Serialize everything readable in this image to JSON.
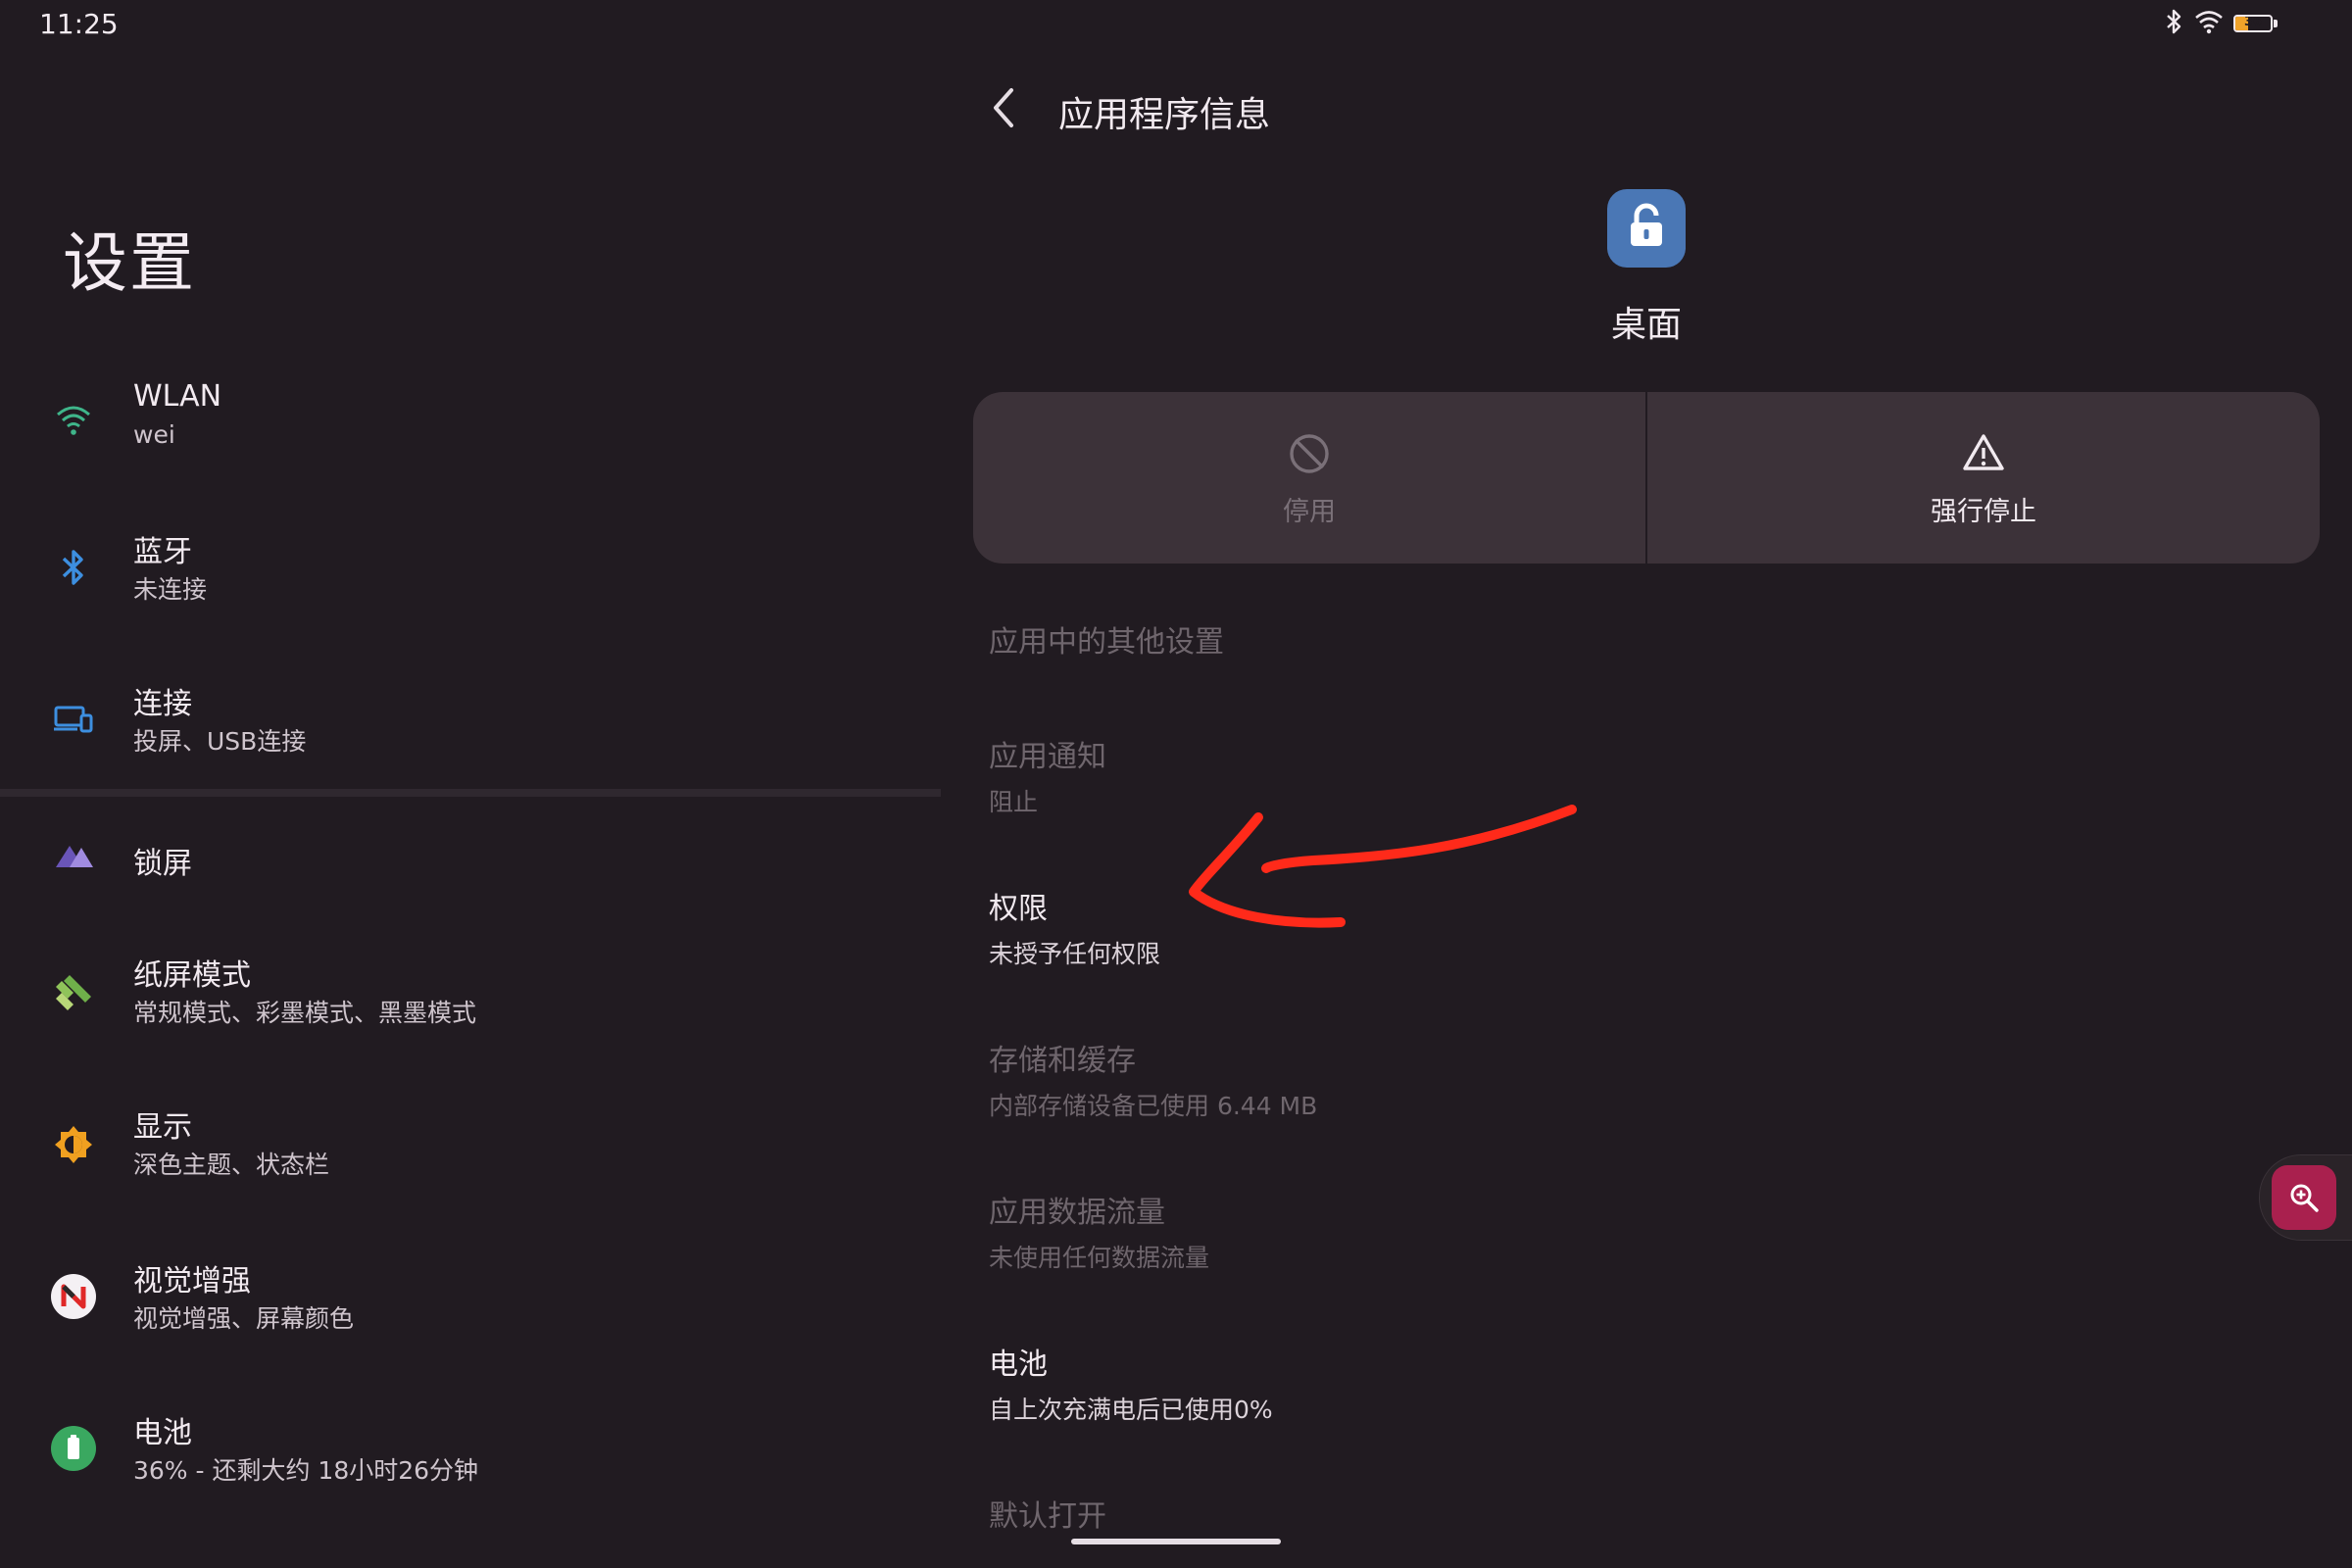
{
  "status_bar": {
    "time": "11:25",
    "battery_level": "36",
    "battery_percent": 0.36,
    "icons": [
      "bluetooth-icon",
      "wifi-icon",
      "battery-icon"
    ]
  },
  "settings_list": {
    "title": "设置",
    "items": [
      {
        "id": "wlan",
        "title": "WLAN",
        "subtitle": "wei",
        "icon": "wifi-icon",
        "icon_color": "#3fb58a"
      },
      {
        "id": "bluetooth",
        "title": "蓝牙",
        "subtitle": "未连接",
        "icon": "bluetooth-icon",
        "icon_color": "#3d8fe0"
      },
      {
        "id": "connect",
        "title": "连接",
        "subtitle": "投屏、USB连接",
        "icon": "devices-icon",
        "icon_color": "#3d8fe0"
      },
      {
        "id": "lockscreen",
        "title": "锁屏",
        "subtitle": "",
        "icon": "lockscreen-icon",
        "icon_color": "#8a6fd1"
      },
      {
        "id": "paper-mode",
        "title": "纸屏模式",
        "subtitle": "常规模式、彩墨模式、黑墨模式",
        "icon": "paper-mode-icon",
        "icon_color": "#8fc45a"
      },
      {
        "id": "display",
        "title": "显示",
        "subtitle": "深色主题、状态栏",
        "icon": "brightness-icon",
        "icon_color": "#f0a020"
      },
      {
        "id": "visual",
        "title": "视觉增强",
        "subtitle": "视觉增强、屏幕颜色",
        "icon": "visual-enhance-icon",
        "icon_color": "#e83030"
      },
      {
        "id": "battery",
        "title": "电池",
        "subtitle": "36% - 还剩大约 18小时26分钟",
        "icon": "battery-icon",
        "icon_color": "#3aa860"
      }
    ]
  },
  "app_info": {
    "page_title": "应用程序信息",
    "app_name": "桌面",
    "app_icon": "lock-icon",
    "app_icon_color": "#4a77b5",
    "actions": {
      "disable": {
        "label": "停用",
        "icon": "disable-icon",
        "enabled": false
      },
      "force_stop": {
        "label": "强行停止",
        "icon": "warning-icon",
        "enabled": true
      }
    },
    "items": [
      {
        "id": "other-settings",
        "title": "应用中的其他设置",
        "subtitle": "",
        "enabled": false
      },
      {
        "id": "notifications",
        "title": "应用通知",
        "subtitle": "阻止",
        "enabled": false
      },
      {
        "id": "permissions",
        "title": "权限",
        "subtitle": "未授予任何权限",
        "enabled": true
      },
      {
        "id": "storage",
        "title": "存储和缓存",
        "subtitle": "内部存储设备已使用 6.44 MB",
        "enabled": false
      },
      {
        "id": "data-usage",
        "title": "应用数据流量",
        "subtitle": "未使用任何数据流量",
        "enabled": false
      },
      {
        "id": "battery",
        "title": "电池",
        "subtitle": "自上次充满电后已使用0%",
        "enabled": true
      },
      {
        "id": "open-by-default",
        "title": "默认打开",
        "subtitle": "",
        "enabled": false
      }
    ]
  },
  "annotation": {
    "color": "#ff2a1a",
    "shape": "arrow"
  },
  "zoom_button": {
    "icon": "zoom-in-icon",
    "color": "#a9204e"
  }
}
